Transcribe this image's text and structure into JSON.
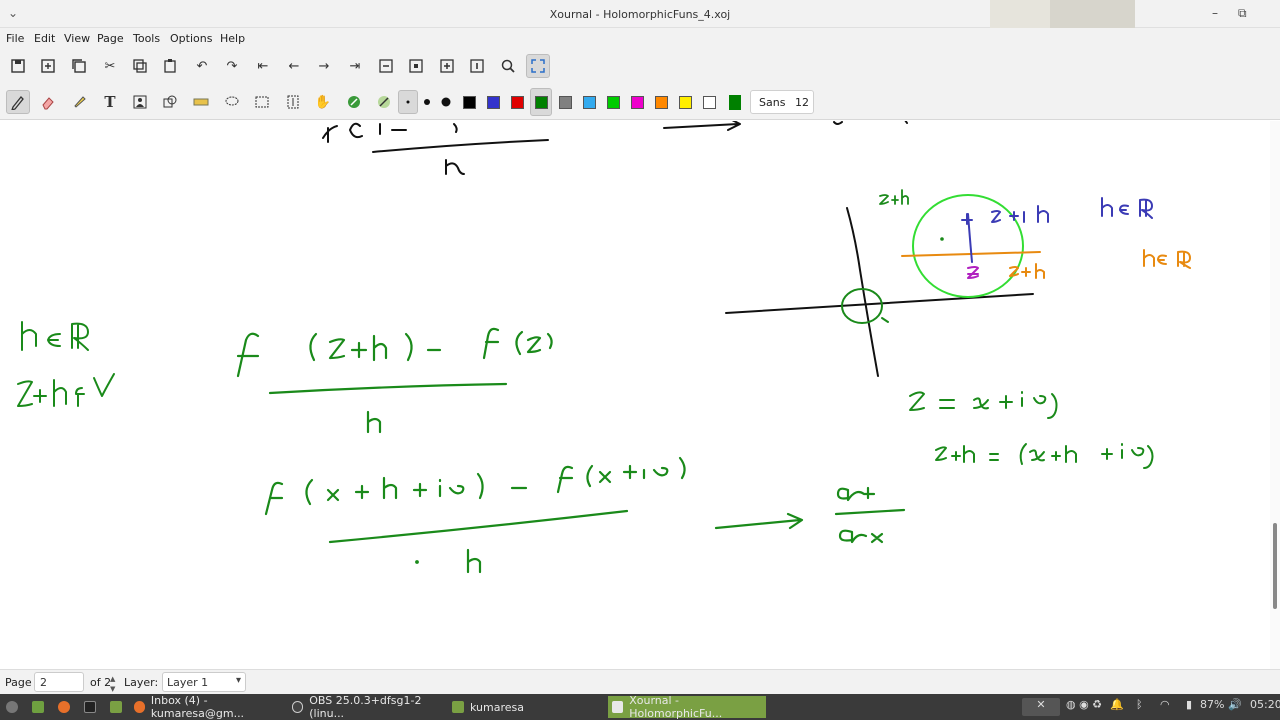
{
  "window": {
    "title": "Xournal - HolomorphicFuns_4.xoj",
    "controls": [
      "–",
      "⧉",
      "✕"
    ]
  },
  "menu": [
    "File",
    "Edit",
    "View",
    "Page",
    "Tools",
    "Options",
    "Help"
  ],
  "toolbar": {
    "font_name": "Sans",
    "font_size": "12",
    "colors": [
      "#000000",
      "#3333cc",
      "#e00000",
      "#008000",
      "#808080",
      "#33aaee",
      "#00cc00",
      "#ee00cc",
      "#ff8800",
      "#ffee00",
      "#ffffff",
      "#008000"
    ],
    "selected_color": "#008000"
  },
  "statusbar": {
    "page_label": "Page",
    "page_value": "2",
    "of_label": "of 2",
    "layer_label": "Layer:",
    "layer_value": "Layer 1"
  },
  "taskbar": {
    "tasks": [
      {
        "label": "Inbox (4) - kumaresa@gm..."
      },
      {
        "label": "OBS 25.0.3+dfsg1-2 (linu..."
      },
      {
        "label": "kumaresa"
      },
      {
        "label": "Xournal - HolomorphicFu..."
      }
    ],
    "battery": "87%",
    "clock": "05:20"
  },
  "ink_colors": {
    "green": "#1a8a1a",
    "black": "#111111",
    "blue": "#3b3bb5",
    "orange": "#e88a10",
    "purple": "#b020c0",
    "bright_green": "#33dd33"
  }
}
